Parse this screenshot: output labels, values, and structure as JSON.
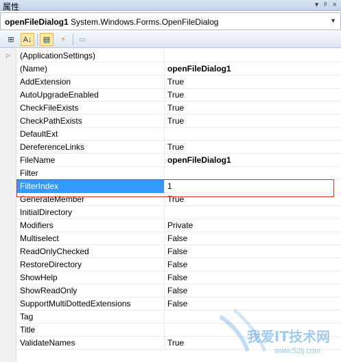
{
  "window": {
    "title": "属性",
    "title_buttons": [
      "▾",
      "ᵖ",
      "×"
    ]
  },
  "selector": {
    "object_name": "openFileDialog1",
    "object_type": "System.Windows.Forms.OpenFileDialog"
  },
  "toolbar": {
    "buttons": [
      {
        "name": "categorized-button",
        "glyph": "⊞"
      },
      {
        "name": "alphabetical-button",
        "glyph": "A↓"
      },
      {
        "name": "properties-button",
        "glyph": "▤"
      },
      {
        "name": "events-button",
        "glyph": "⚡"
      },
      {
        "name": "property-pages-button",
        "glyph": "▭"
      }
    ]
  },
  "properties": [
    {
      "name": "(ApplicationSettings)",
      "value": "",
      "bold": false,
      "expandable": true
    },
    {
      "name": "(Name)",
      "value": "openFileDialog1",
      "bold": true
    },
    {
      "name": "AddExtension",
      "value": "True",
      "bold": false
    },
    {
      "name": "AutoUpgradeEnabled",
      "value": "True",
      "bold": false
    },
    {
      "name": "CheckFileExists",
      "value": "True",
      "bold": false
    },
    {
      "name": "CheckPathExists",
      "value": "True",
      "bold": false
    },
    {
      "name": "DefaultExt",
      "value": "",
      "bold": false
    },
    {
      "name": "DereferenceLinks",
      "value": "True",
      "bold": false
    },
    {
      "name": "FileName",
      "value": "openFileDialog1",
      "bold": true
    },
    {
      "name": "Filter",
      "value": "",
      "bold": false
    },
    {
      "name": "FilterIndex",
      "value": "1",
      "bold": false,
      "selected": true
    },
    {
      "name": "GenerateMember",
      "value": "True",
      "bold": false
    },
    {
      "name": "InitialDirectory",
      "value": "",
      "bold": false
    },
    {
      "name": "Modifiers",
      "value": "Private",
      "bold": false
    },
    {
      "name": "Multiselect",
      "value": "False",
      "bold": false
    },
    {
      "name": "ReadOnlyChecked",
      "value": "False",
      "bold": false
    },
    {
      "name": "RestoreDirectory",
      "value": "False",
      "bold": false
    },
    {
      "name": "ShowHelp",
      "value": "False",
      "bold": false
    },
    {
      "name": "ShowReadOnly",
      "value": "False",
      "bold": false
    },
    {
      "name": "SupportMultiDottedExtensions",
      "value": "False",
      "bold": false
    },
    {
      "name": "Tag",
      "value": "",
      "bold": false
    },
    {
      "name": "Title",
      "value": "",
      "bold": false
    },
    {
      "name": "ValidateNames",
      "value": "True",
      "bold": false
    }
  ],
  "watermark": {
    "text": "我爱IT技术网",
    "url": "www.52ij.com"
  },
  "colors": {
    "selection": "#3399ff",
    "highlight_border": "#d9342b",
    "watermark": "#5aa0dc"
  }
}
